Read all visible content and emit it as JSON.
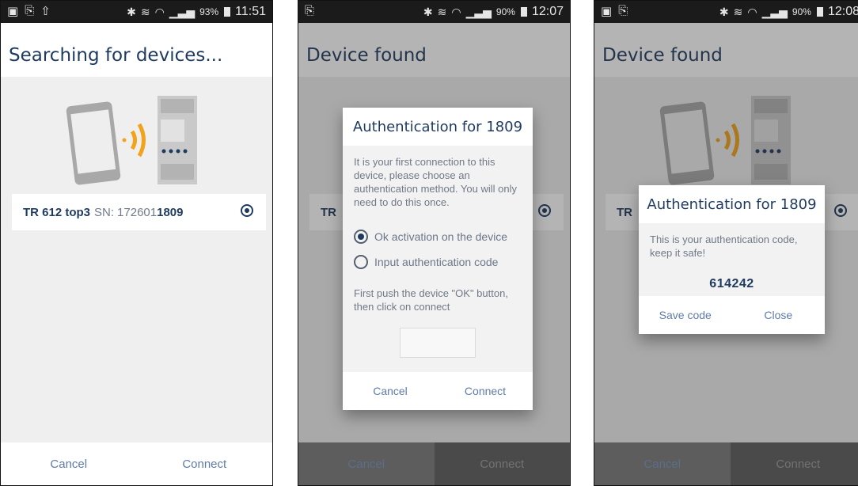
{
  "screen1": {
    "status": {
      "battery": "93%",
      "time": "11:51"
    },
    "title": "Searching for devices...",
    "device": {
      "model": "TR 612 top3",
      "sn_label": "SN:",
      "sn_prefix": "172601",
      "sn_suffix": "1809"
    },
    "cancel": "Cancel",
    "connect": "Connect"
  },
  "screen2": {
    "status": {
      "battery": "90%",
      "time": "12:07"
    },
    "title": "Device found",
    "device_row_text": "TR",
    "dialog": {
      "title": "Authentication for 1809",
      "message": "It is your first connection to this device, please choose an authentication method. You will only need to do this once.",
      "option1": "Ok activation on the device",
      "option2": "Input authentication code",
      "hint": "First push the device \"OK\" button, then click on connect",
      "cancel": "Cancel",
      "connect": "Connect"
    },
    "cancel": "Cancel",
    "connect": "Connect"
  },
  "screen3": {
    "status": {
      "battery": "90%",
      "time": "12:08"
    },
    "title": "Device found",
    "device_row_text": "TR",
    "dialog": {
      "title": "Authentication for 1809",
      "message": "This is your authentication code, keep it safe!",
      "code": "614242",
      "save": "Save code",
      "close": "Close"
    },
    "cancel": "Cancel",
    "connect": "Connect"
  },
  "colors": {
    "accent": "#1f3a5f",
    "link": "#5f7ba8",
    "signal": "#f2a21b",
    "statusbar": "#1b1b1b"
  }
}
